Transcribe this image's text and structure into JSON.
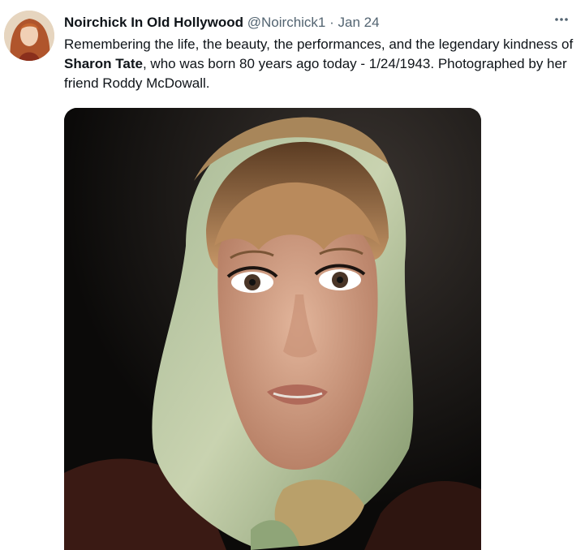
{
  "tweet": {
    "display_name": "Noirchick In Old Hollywood",
    "handle": "@Noirchick1",
    "separator": "·",
    "date": "Jan 24",
    "more_icon": "more-horizontal-icon",
    "text_part1": "Remembering the life, the beauty, the performances,  and the legendary kindness of ",
    "text_bold": "Sharon Tate",
    "text_part2": ", who was born 80 years ago today - 1/24/1943. Photographed by her friend Roddy McDowall."
  },
  "colors": {
    "text_primary": "#0f1419",
    "text_secondary": "#536471"
  }
}
